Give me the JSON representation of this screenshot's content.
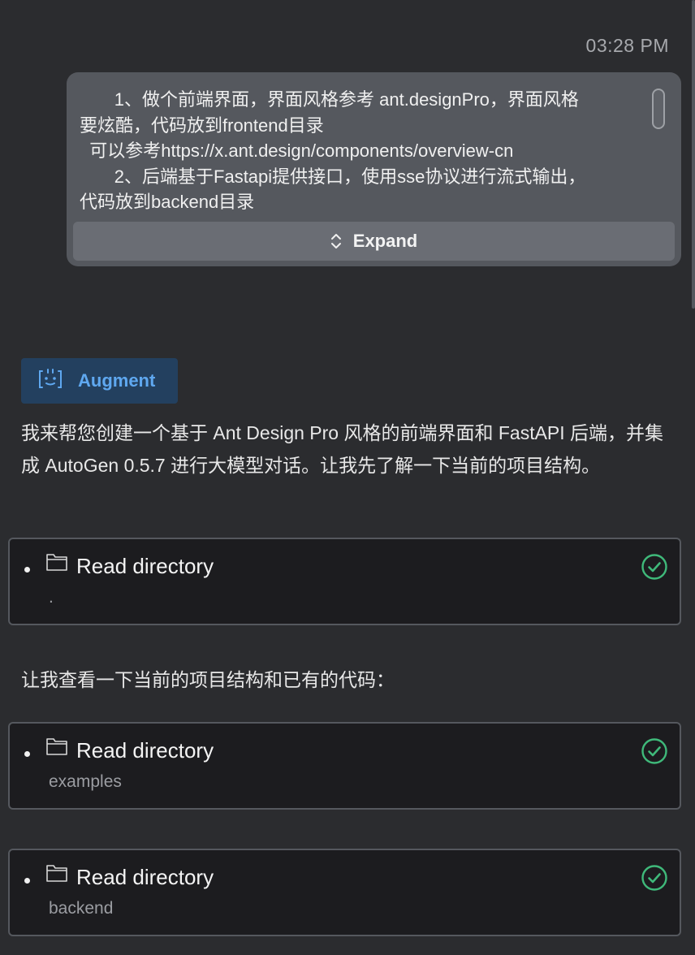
{
  "header": {
    "timestamp": "03:28 PM"
  },
  "user_message": {
    "text": "       1、做个前端界面，界面风格参考 ant.designPro，界面风格\n要炫酷，代码放到frontend目录\n  可以参考https://x.ant.design/components/overview-cn\n       2、后端基于Fastapi提供接口，使用sse协议进行流式输出，\n代码放到backend目录",
    "expand_label": "Expand",
    "expand_icon": "chevron-up-down-icon"
  },
  "assistant": {
    "badge_label": "Augment",
    "badge_icon": "robot-face-icon",
    "accent_color": "#5fa8f0",
    "message_1": "我来帮您创建一个基于 Ant Design Pro 风格的前端界面和 FastAPI 后端，并集成 AutoGen 0.5.7 进行大模型对话。让我先了解一下当前的项目结构。",
    "message_2": "让我查看一下当前的项目结构和已有的代码："
  },
  "tool_calls": [
    {
      "title": "Read directory",
      "path": ".",
      "status": "success",
      "icon": "folder-icon",
      "status_color": "#3fb97a"
    },
    {
      "title": "Read directory",
      "path": "examples",
      "status": "success",
      "icon": "folder-icon",
      "status_color": "#3fb97a"
    },
    {
      "title": "Read directory",
      "path": "backend",
      "status": "success",
      "icon": "folder-icon",
      "status_color": "#3fb97a"
    }
  ]
}
